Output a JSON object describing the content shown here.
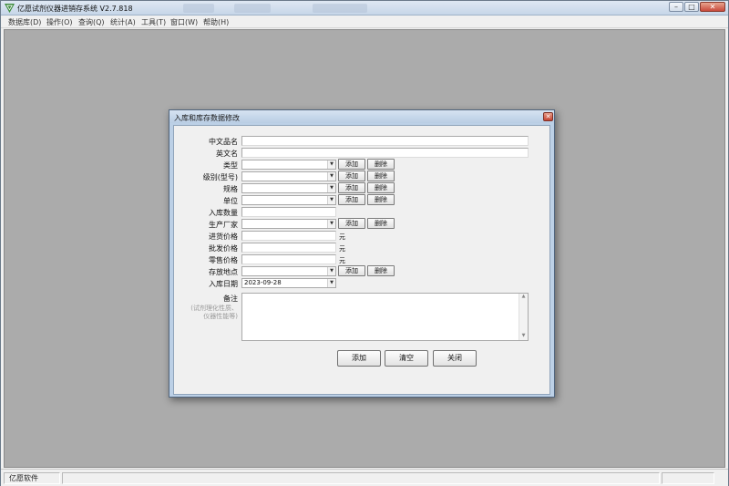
{
  "app": {
    "title": "亿愿试剂仪器进销存系统 V2.7.818",
    "accent_color": "#3a8a3a"
  },
  "menubar": {
    "items": [
      {
        "label": "数据库(D)"
      },
      {
        "label": "操作(O)"
      },
      {
        "label": "查询(Q)"
      },
      {
        "label": "统计(A)"
      },
      {
        "label": "工具(T)"
      },
      {
        "label": "窗口(W)"
      },
      {
        "label": "帮助(H)"
      }
    ]
  },
  "window_controls": {
    "minimize": "–",
    "maximize": "□",
    "close": "✕"
  },
  "dialog": {
    "title": "入库和库存数据修改",
    "close": "✕",
    "fields": {
      "cn_name_label": "中文品名",
      "en_name_label": "英文名",
      "type_label": "类型",
      "level_label": "级别(型号)",
      "spec_label": "规格",
      "unit_label": "单位",
      "qty_label": "入库数量",
      "maker_label": "生产厂家",
      "purchase_price_label": "进货价格",
      "wholesale_price_label": "批发价格",
      "retail_price_label": "零售价格",
      "location_label": "存放地点",
      "date_label": "入库日期",
      "remark_label": "备注",
      "date_value": "2023-09-28",
      "currency": "元",
      "remark_hint": "(试剂理化性质、仪器性能等)"
    },
    "row_buttons": {
      "add": "添加",
      "delete": "删除"
    },
    "bottom_buttons": {
      "add": "添加",
      "clear": "清空",
      "close": "关闭"
    }
  },
  "statusbar": {
    "company": "亿愿软件"
  }
}
